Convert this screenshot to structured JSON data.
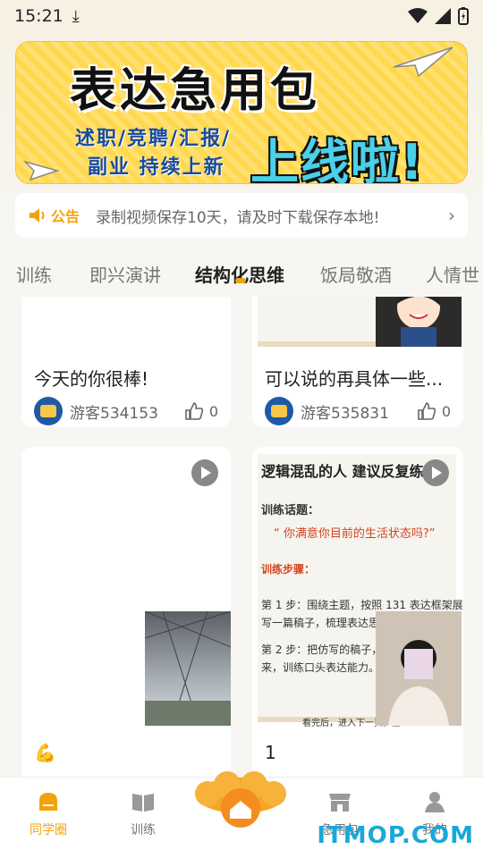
{
  "status": {
    "time": "15:21"
  },
  "banner": {
    "title": "表达急用包",
    "line1": "述职/竞聘/汇报/",
    "line2": "副业 持续上新",
    "highlight": "上线啦!"
  },
  "notice": {
    "label": "公告",
    "text": "录制视频保存10天，请及时下载保存本地!"
  },
  "tabs": [
    "训练",
    "即兴演讲",
    "结构化思维",
    "饭局敬酒",
    "人情世"
  ],
  "active_tab": "结构化思维",
  "cards": [
    {
      "text": "今天的你很棒!",
      "user": "游客534153",
      "likes": "0"
    },
    {
      "text": "可以说的再具体一些...",
      "user": "游客535831",
      "likes": "0"
    },
    {
      "text": "💪"
    },
    {
      "text": "1"
    }
  ],
  "slide": {
    "heading": "逻辑混乱的人  建议反复练习",
    "topic_label": "训练话题：",
    "topic": "“ 你满意你目前的生活状态吗?”",
    "steps_label": "训练步骤：",
    "step1": "第 1 步：围绕主题，按照 131 表达框架展开",
    "step1b": "写一篇稿子，梳理表达思路。",
    "step2": "第 2 步：把仿写的稿子，",
    "step2b": "来，训练口头表达能力。",
    "footer": "看完后，进入下一页，查"
  },
  "nav": [
    "同学圈",
    "训练",
    "急用包",
    "我的"
  ],
  "watermark": "ITMOP.COM",
  "colors": {
    "accent": "#f2a20c",
    "banner": "#ffd84d",
    "brand_blue": "#1e5aa8"
  }
}
